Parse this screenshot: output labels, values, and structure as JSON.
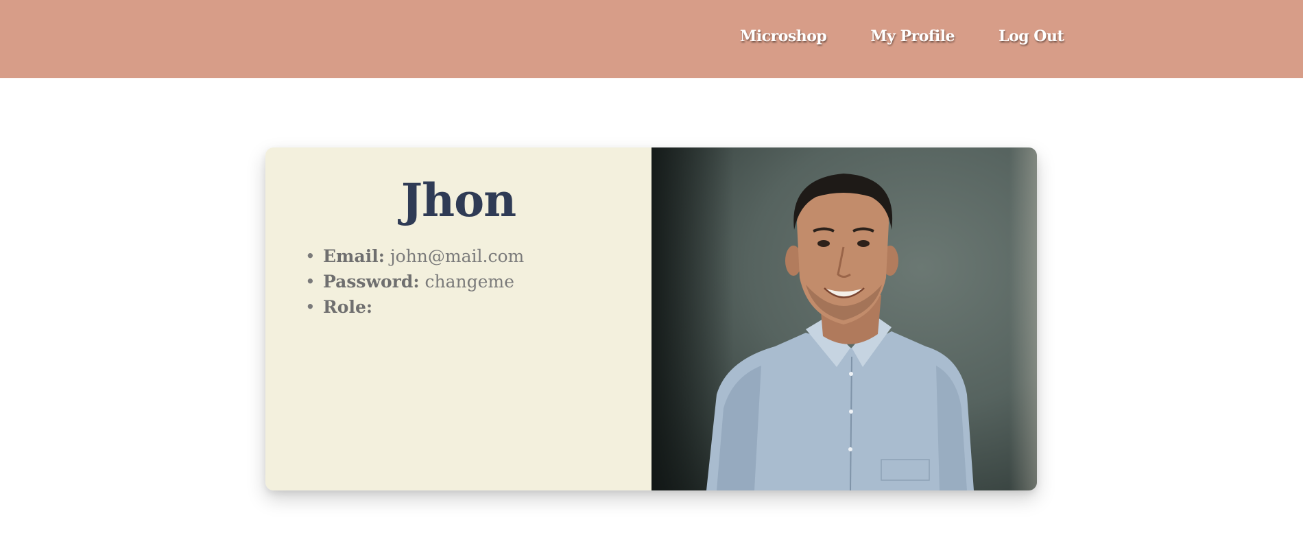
{
  "nav": {
    "links": [
      "Microshop",
      "My Profile",
      "Log Out"
    ]
  },
  "profile": {
    "name": "Jhon",
    "details": [
      {
        "label": "Email:",
        "value": "john@mail.com"
      },
      {
        "label": "Password:",
        "value": "changeme"
      },
      {
        "label": "Role:",
        "value": ""
      }
    ],
    "photo": "avatar-photo"
  },
  "colors": {
    "navbar": "#d79d88",
    "card_info_bg": "#f3f0dd",
    "name_color": "#2f3b55",
    "text_gray": "#7a7a7a"
  },
  "icons": {
    "bullet": "bullet-dot"
  }
}
